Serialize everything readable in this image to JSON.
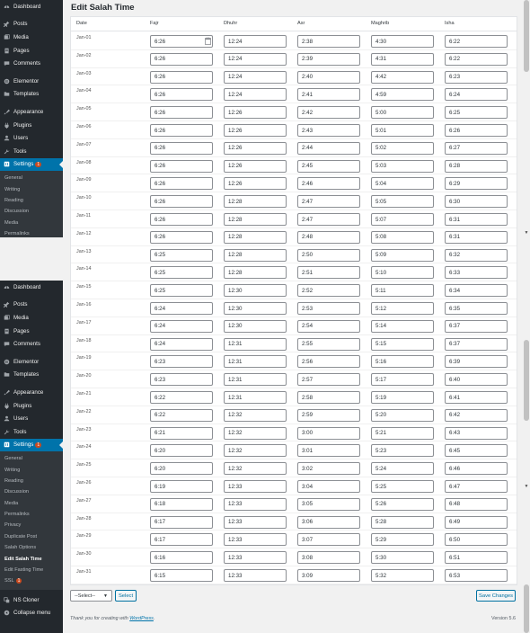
{
  "page_title": "Edit Salah Time",
  "sidebar_top": {
    "items": [
      {
        "label": "Dashboard",
        "icon": "dashboard-icon"
      },
      {
        "gap": true
      },
      {
        "label": "Posts",
        "icon": "pin-icon"
      },
      {
        "label": "Media",
        "icon": "media-icon"
      },
      {
        "label": "Pages",
        "icon": "page-icon"
      },
      {
        "label": "Comments",
        "icon": "comment-icon"
      },
      {
        "gap": true
      },
      {
        "label": "Elementor",
        "icon": "elementor-icon"
      },
      {
        "label": "Templates",
        "icon": "folder-icon"
      },
      {
        "gap": true
      },
      {
        "label": "Appearance",
        "icon": "brush-icon"
      },
      {
        "label": "Plugins",
        "icon": "plug-icon"
      },
      {
        "label": "Users",
        "icon": "user-icon"
      },
      {
        "label": "Tools",
        "icon": "wrench-icon"
      },
      {
        "label": "Settings",
        "icon": "settings-icon",
        "badge": "1",
        "active": true
      }
    ],
    "submenu": [
      "General",
      "Writing",
      "Reading",
      "Discussion",
      "Media",
      "Permalinks"
    ]
  },
  "sidebar_bottom": {
    "items": [
      {
        "label": "Dashboard",
        "icon": "dashboard-icon"
      },
      {
        "gap": true
      },
      {
        "label": "Posts",
        "icon": "pin-icon"
      },
      {
        "label": "Media",
        "icon": "media-icon"
      },
      {
        "label": "Pages",
        "icon": "page-icon"
      },
      {
        "label": "Comments",
        "icon": "comment-icon"
      },
      {
        "gap": true
      },
      {
        "label": "Elementor",
        "icon": "elementor-icon"
      },
      {
        "label": "Templates",
        "icon": "folder-icon"
      },
      {
        "gap": true
      },
      {
        "label": "Appearance",
        "icon": "brush-icon"
      },
      {
        "label": "Plugins",
        "icon": "plug-icon"
      },
      {
        "label": "Users",
        "icon": "user-icon"
      },
      {
        "label": "Tools",
        "icon": "wrench-icon"
      },
      {
        "label": "Settings",
        "icon": "settings-icon",
        "badge": "1",
        "active": true
      }
    ],
    "submenu": [
      {
        "label": "General"
      },
      {
        "label": "Writing"
      },
      {
        "label": "Reading"
      },
      {
        "label": "Discussion"
      },
      {
        "label": "Media"
      },
      {
        "label": "Permalinks"
      },
      {
        "label": "Privacy"
      },
      {
        "label": "Duplicate Post"
      },
      {
        "label": "Salah Options"
      },
      {
        "label": "Edit Salah Time",
        "current": true
      },
      {
        "label": "Edit Fasting Time"
      },
      {
        "label": "SSL",
        "badge": "1"
      }
    ],
    "after": [
      {
        "label": "NS Cloner",
        "icon": "cloner-icon"
      },
      {
        "label": "Collapse menu",
        "icon": "collapse-icon"
      }
    ]
  },
  "table": {
    "columns": [
      "Date",
      "Fajr",
      "Dhuhr",
      "Asr",
      "Maghrib",
      "Isha"
    ],
    "rows": [
      [
        "Jan-01",
        "6:26",
        "12:24",
        "2:38",
        "4:30",
        "6:22"
      ],
      [
        "Jan-02",
        "6:26",
        "12:24",
        "2:39",
        "4:31",
        "6:22"
      ],
      [
        "Jan-03",
        "6:26",
        "12:24",
        "2:40",
        "4:42",
        "6:23"
      ],
      [
        "Jan-04",
        "6:26",
        "12:24",
        "2:41",
        "4:59",
        "6:24"
      ],
      [
        "Jan-05",
        "6:26",
        "12:26",
        "2:42",
        "5:00",
        "6:25"
      ],
      [
        "Jan-06",
        "6:26",
        "12:26",
        "2:43",
        "5:01",
        "6:26"
      ],
      [
        "Jan-07",
        "6:26",
        "12:26",
        "2:44",
        "5:02",
        "6:27"
      ],
      [
        "Jan-08",
        "6:26",
        "12:26",
        "2:45",
        "5:03",
        "6:28"
      ],
      [
        "Jan-09",
        "6:26",
        "12:26",
        "2:46",
        "5:04",
        "6:29"
      ],
      [
        "Jan-10",
        "6:26",
        "12:28",
        "2:47",
        "5:05",
        "6:30"
      ],
      [
        "Jan-11",
        "6:26",
        "12:28",
        "2:47",
        "5:07",
        "6:31"
      ],
      [
        "Jan-12",
        "6:26",
        "12:28",
        "2:48",
        "5:08",
        "6:31"
      ],
      [
        "Jan-13",
        "6:25",
        "12:28",
        "2:50",
        "5:09",
        "6:32"
      ],
      [
        "Jan-14",
        "6:25",
        "12:28",
        "2:51",
        "5:10",
        "6:33"
      ],
      [
        "Jan-15",
        "6:25",
        "12:30",
        "2:52",
        "5:11",
        "6:34"
      ],
      [
        "Jan-16",
        "6:24",
        "12:30",
        "2:53",
        "5:12",
        "6:35"
      ],
      [
        "Jan-17",
        "6:24",
        "12:30",
        "2:54",
        "5:14",
        "6:37"
      ],
      [
        "Jan-18",
        "6:24",
        "12:31",
        "2:55",
        "5:15",
        "6:37"
      ],
      [
        "Jan-19",
        "6:23",
        "12:31",
        "2:56",
        "5:16",
        "6:39"
      ],
      [
        "Jan-20",
        "6:23",
        "12:31",
        "2:57",
        "5:17",
        "6:40"
      ],
      [
        "Jan-21",
        "6:22",
        "12:31",
        "2:58",
        "5:19",
        "6:41"
      ],
      [
        "Jan-22",
        "6:22",
        "12:32",
        "2:59",
        "5:20",
        "6:42"
      ],
      [
        "Jan-23",
        "6:21",
        "12:32",
        "3:00",
        "5:21",
        "6:43"
      ],
      [
        "Jan-24",
        "6:20",
        "12:32",
        "3:01",
        "5:23",
        "6:45"
      ],
      [
        "Jan-25",
        "6:20",
        "12:32",
        "3:02",
        "5:24",
        "6:46"
      ],
      [
        "Jan-26",
        "6:19",
        "12:33",
        "3:04",
        "5:25",
        "6:47"
      ],
      [
        "Jan-27",
        "6:18",
        "12:33",
        "3:05",
        "5:26",
        "6:48"
      ],
      [
        "Jan-28",
        "6:17",
        "12:33",
        "3:06",
        "5:28",
        "6:49"
      ],
      [
        "Jan-29",
        "6:17",
        "12:33",
        "3:07",
        "5:29",
        "6:50"
      ],
      [
        "Jan-30",
        "6:16",
        "12:33",
        "3:08",
        "5:30",
        "6:51"
      ],
      [
        "Jan-31",
        "6:15",
        "12:33",
        "3:09",
        "5:32",
        "6:53"
      ]
    ]
  },
  "controls": {
    "bulk_select": "--Select--",
    "select_button": "Select",
    "save_button": "Save Changes"
  },
  "footer": {
    "thanks_prefix": "Thank you for creating with ",
    "wordpress_link": "WordPress",
    "thanks_suffix": ".",
    "version": "Version 5.6"
  },
  "colors": {
    "sidebar_bg": "#23282d",
    "sidebar_sub_bg": "#32373c",
    "active_blue": "#0073aa",
    "badge_orange": "#ca4a1f",
    "button_blue": "#0071a1"
  }
}
